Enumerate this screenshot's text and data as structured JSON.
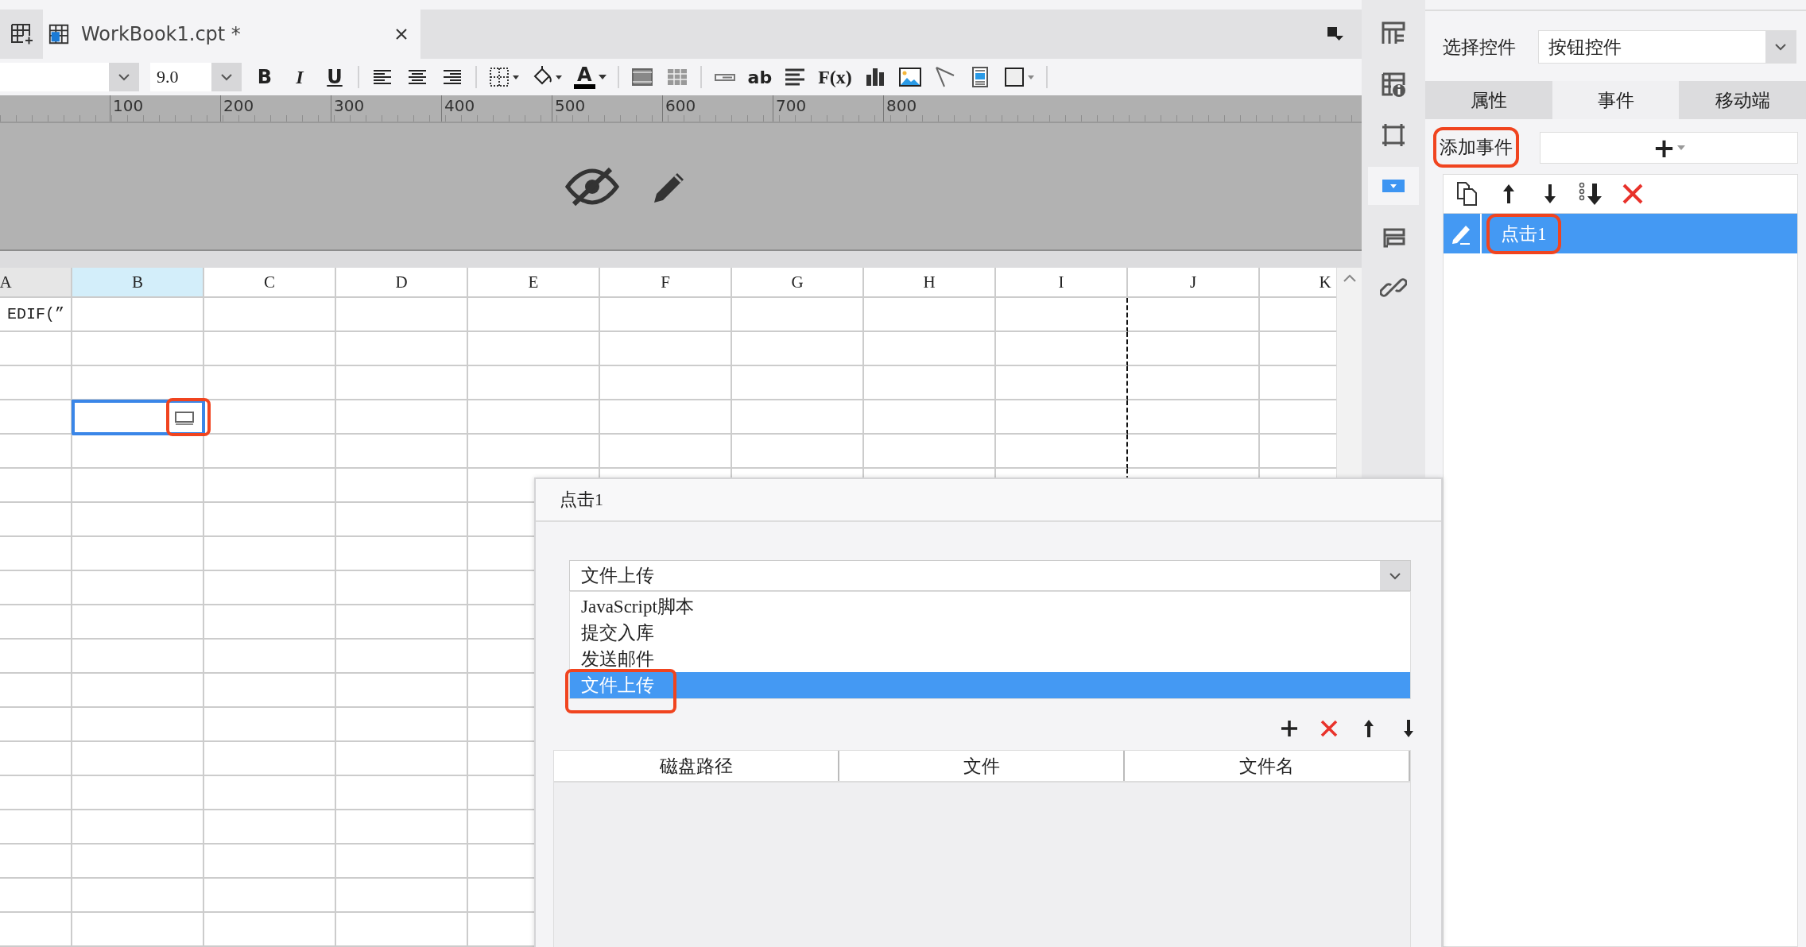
{
  "tabs": [
    {
      "label": "WorkBook1.cpt *",
      "selected": true
    }
  ],
  "toolbar": {
    "font_size": "9.0",
    "items": [
      {
        "kind": "bold",
        "text": "B"
      },
      {
        "kind": "italic",
        "text": "I"
      },
      {
        "kind": "underline",
        "text": "U"
      },
      {
        "kind": "sep"
      },
      {
        "kind": "align-left"
      },
      {
        "kind": "align-center"
      },
      {
        "kind": "align-right"
      },
      {
        "kind": "sep"
      },
      {
        "kind": "borders"
      },
      {
        "kind": "fill"
      },
      {
        "kind": "font-color",
        "text": "A"
      },
      {
        "kind": "sep"
      },
      {
        "kind": "merge"
      },
      {
        "kind": "grid"
      },
      {
        "kind": "sep"
      },
      {
        "kind": "field"
      },
      {
        "kind": "textbox",
        "text": "ab"
      },
      {
        "kind": "lines"
      },
      {
        "kind": "formula",
        "text": "F(x)"
      },
      {
        "kind": "chart"
      },
      {
        "kind": "image"
      },
      {
        "kind": "slash"
      },
      {
        "kind": "doc"
      },
      {
        "kind": "frame"
      },
      {
        "kind": "sep"
      }
    ]
  },
  "ruler": {
    "ticks": [
      "100",
      "200",
      "300",
      "400",
      "500",
      "600",
      "700",
      "800"
    ]
  },
  "sheet": {
    "columns": [
      {
        "label": "A",
        "selected": false,
        "page_break": false
      },
      {
        "label": "B",
        "selected": true,
        "page_break": false
      },
      {
        "label": "C",
        "selected": false,
        "page_break": false
      },
      {
        "label": "D",
        "selected": false,
        "page_break": false
      },
      {
        "label": "E",
        "selected": false,
        "page_break": false
      },
      {
        "label": "F",
        "selected": false,
        "page_break": false
      },
      {
        "label": "G",
        "selected": false,
        "page_break": false
      },
      {
        "label": "H",
        "selected": false,
        "page_break": false
      },
      {
        "label": "I",
        "selected": false,
        "page_break": true
      },
      {
        "label": "J",
        "selected": false,
        "page_break": false
      },
      {
        "label": "K",
        "selected": false,
        "page_break": false
      }
    ],
    "rows": [
      {
        "selected": false,
        "text": "EDIF(”"
      },
      {
        "selected": false
      },
      {
        "selected": false
      },
      {
        "selected": true,
        "highlighted": true
      },
      {
        "selected": false
      },
      {
        "selected": false
      },
      {
        "selected": false
      },
      {
        "selected": false
      },
      {
        "selected": false
      },
      {
        "selected": false
      },
      {
        "selected": false
      },
      {
        "selected": false
      },
      {
        "selected": false
      },
      {
        "selected": false
      },
      {
        "selected": false
      },
      {
        "selected": false
      },
      {
        "selected": false
      },
      {
        "selected": false
      },
      {
        "selected": false
      }
    ]
  },
  "side_tools": [
    {
      "kind": "layout",
      "selected": false
    },
    {
      "kind": "cell-info",
      "selected": false
    },
    {
      "kind": "crop",
      "selected": false
    },
    {
      "kind": "widget",
      "selected": true
    },
    {
      "kind": "stack",
      "selected": false
    },
    {
      "kind": "link",
      "selected": false
    }
  ],
  "panel": {
    "select_label": "选择控件",
    "select_value": "按钮控件",
    "tabs": [
      {
        "label": "属性",
        "selected": false
      },
      {
        "label": "事件",
        "selected": true
      },
      {
        "label": "移动端",
        "selected": false
      }
    ],
    "add_event": {
      "label": "添加事件",
      "highlighted": true,
      "button": "+"
    },
    "events": [
      {
        "label": "点击1",
        "selected": true,
        "highlighted": true
      }
    ]
  },
  "dialog": {
    "title": "点击1",
    "action": {
      "value": "文件上传",
      "options": [
        {
          "label": "JavaScript脚本",
          "selected": false,
          "highlighted": false
        },
        {
          "label": "提交入库",
          "selected": false,
          "highlighted": false
        },
        {
          "label": "发送邮件",
          "selected": false,
          "highlighted": false
        },
        {
          "label": "文件上传",
          "selected": true,
          "highlighted": true
        }
      ]
    },
    "table_columns": [
      "磁盘路径",
      "文件",
      "文件名"
    ]
  }
}
